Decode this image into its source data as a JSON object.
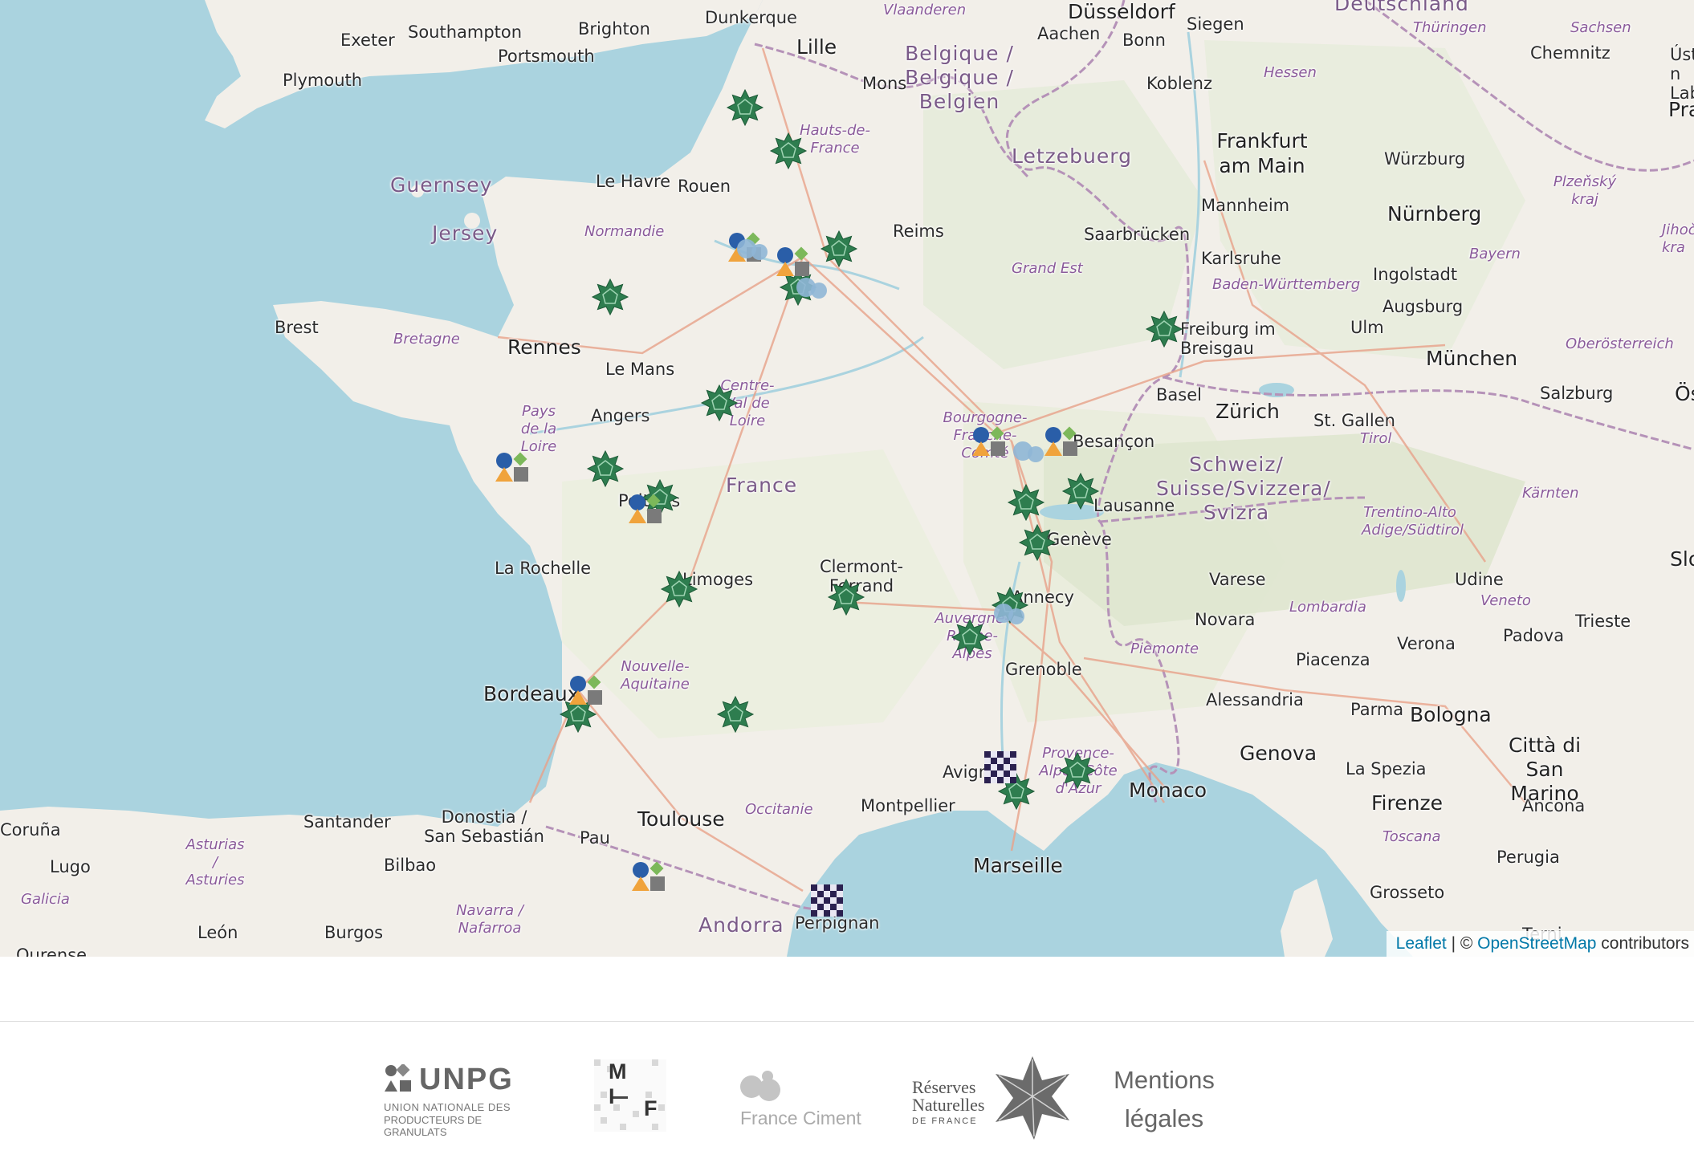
{
  "map": {
    "labels": {
      "countries": [
        "Belgique / Belgique / Belgien",
        "France",
        "Letzebuerg",
        "Schweiz/ Suisse/Svizzera/ Svizra",
        "Deutschland",
        "Andorra",
        "Monaco",
        "Città di San Marino"
      ],
      "seas": []
    },
    "cities": {
      "exeter": "Exeter",
      "southampton": "Southampton",
      "brighton": "Brighton",
      "dunkerque": "Dunkerque",
      "plymouth": "Plymouth",
      "portsmouth": "Portsmouth",
      "lille": "Lille",
      "mons": "Mons",
      "dusseldorf": "Düsseldorf",
      "aachen": "Aachen",
      "bonn": "Bonn",
      "siegen": "Siegen",
      "koblenz": "Koblenz",
      "frankfurt": "Frankfurt am Main",
      "wurzburg": "Würzburg",
      "chemnitz": "Chemnitz",
      "guernsey": "Guernsey",
      "jersey": "Jersey",
      "lehavre": "Le Havre",
      "rouen": "Rouen",
      "reims": "Reims",
      "mannheim": "Mannheim",
      "nurnberg": "Nürnberg",
      "saarbrucken": "Saarbrücken",
      "karlsruhe": "Karlsruhe",
      "ingolstadt": "Ingolstadt",
      "augsburg": "Augsburg",
      "brest": "Brest",
      "rennes": "Rennes",
      "lemans": "Le Mans",
      "freiburg": "Freiburg im Breisgau",
      "ulm": "Ulm",
      "munchen": "München",
      "angers": "Angers",
      "basel": "Basel",
      "zurich": "Zürich",
      "stgallen": "St. Gallen",
      "salzburg": "Salzburg",
      "besancon": "Besançon",
      "lausanne": "Lausanne",
      "geneve": "Genève",
      "poitiers": "Poitiers",
      "larochelle": "La Rochelle",
      "limoges": "Limoges",
      "clermont": "Clermont-Ferrand",
      "annecy": "Annecy",
      "varese": "Varese",
      "udine": "Udine",
      "novara": "Novara",
      "verona": "Verona",
      "padova": "Padova",
      "trieste": "Trieste",
      "grenoble": "Grenoble",
      "piacenza": "Piacenza",
      "alessandria": "Alessandria",
      "parma": "Parma",
      "bologna": "Bologna",
      "bordeaux": "Bordeaux",
      "genova": "Genova",
      "laspezia": "La Spezia",
      "avignon": "Avignon",
      "monaco": "Monaco",
      "donostia": "Donostia / San Sebastián",
      "santander": "Santander",
      "toulouse": "Toulouse",
      "montpellier": "Montpellier",
      "firenze": "Firenze",
      "ancona": "Ancona",
      "coruna": "Coruña",
      "lugo": "Lugo",
      "bilbao": "Bilbao",
      "pau": "Pau",
      "marseille": "Marseille",
      "perugia": "Perugia",
      "grosseto": "Grosseto",
      "leon": "León",
      "burgos": "Burgos",
      "perpignan": "Perpignan",
      "praha": "Praha",
      "usti": "Ústí n Laber",
      "slove": "Slove",
      "oste": "Öste",
      "terni": "Terni",
      "ourense": "Ourense"
    },
    "regions": {
      "vlaanderen": "Vlaanderen",
      "hessen": "Hessen",
      "thuringen": "Thüringen",
      "sachsen": "Sachsen",
      "hauts": "Hauts-de-France",
      "normandie": "Normandie",
      "grandest": "Grand Est",
      "bayern": "Bayern",
      "bw": "Baden-Württemberg",
      "bretagne": "Bretagne",
      "cvl": "Centre-Val de Loire",
      "pdl": "Pays de la Loire",
      "oberost": "Oberösterreich",
      "bfc": "Bourgogne-Franche-Comté",
      "tirol": "Tirol",
      "trentino": "Trentino-Alto Adige/Südtirol",
      "karnten": "Kärnten",
      "veneto": "Veneto",
      "lombardia": "Lombardia",
      "ara": "Auvergne-Rhône-Alpes",
      "piemonte": "Piemonte",
      "na": "Nouvelle-Aquitaine",
      "paca": "Provence-Alpes-Côte d'Azur",
      "occitanie": "Occitanie",
      "asturias": "Asturias / Asturies",
      "galicia": "Galicia",
      "navarra": "Navarra / Nafarroa",
      "toscana": "Toscana",
      "plzen": "Plzeňský kraj",
      "jihoc": "Jihoče kra"
    },
    "attribution": {
      "leaflet": "Leaflet",
      "separator": " | © ",
      "osm": "OpenStreetMap",
      "suffix": " contributors"
    }
  },
  "markers": {
    "reserves": 20,
    "quarry_groups": 7,
    "checkered": 2
  },
  "colors": {
    "water": "#aad3df",
    "land": "#f2efe9",
    "green": "#2e7d4f",
    "blue": "#2a5ea8",
    "orange": "#f0a33c",
    "grey": "#7a7a7a",
    "lightgreen": "#7cb85a",
    "lightblue": "#8fb6d6",
    "checker": "#2b2150"
  },
  "footer": {
    "unpg_title": "UNPG",
    "unpg_sub1": "UNION NATIONALE DES",
    "unpg_sub2": "PRODUCTEURS DE GRANULATS",
    "mif_top": "M I",
    "mif_bottom": "F",
    "france_ciment": "France Ciment",
    "rnf1": "Réserves",
    "rnf2": "Naturelles",
    "rnf3": "DE FRANCE",
    "mentions1": "Mentions",
    "mentions2": "légales"
  }
}
